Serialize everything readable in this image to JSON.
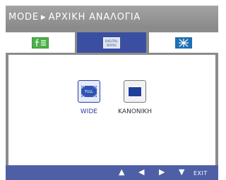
{
  "menu": {
    "title_path": [
      "MODE",
      "ΑΡΧΙΚΗ ΑΝΑΛΟΓΙΑ"
    ],
    "arrow_glyph": "▶"
  },
  "tabs": [
    {
      "name": "picture",
      "icon": "picture-adjust-icon",
      "active": false
    },
    {
      "name": "aspect-ratio",
      "icon": "aspect-ratio-icon",
      "icon_text": [
        "DIGITAL",
        "RATIO"
      ],
      "active": true
    },
    {
      "name": "sharpness",
      "icon": "sharpness-icon",
      "active": false
    }
  ],
  "options": [
    {
      "label": "WIDE",
      "icon_text": "FULL",
      "selected": true
    },
    {
      "label": "ΚΑΝΟΝΙΚΗ",
      "selected": false
    }
  ],
  "footer": {
    "up_glyph": "▲",
    "left_glyph": "◀",
    "right_glyph": "▶",
    "down_glyph": "▼",
    "exit_label": "EXIT"
  },
  "colors": {
    "frame": "#8b8b8b",
    "active_tab": "#3b4fa2",
    "footer": "#4e5fa6",
    "label_blue": "#2c3b94"
  }
}
